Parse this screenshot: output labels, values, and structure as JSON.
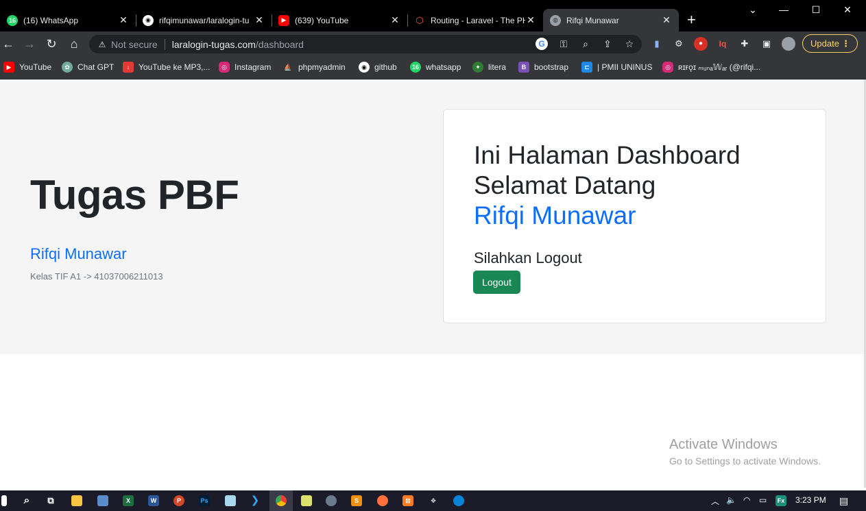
{
  "browser": {
    "tabs": [
      {
        "title": "(16) WhatsApp",
        "icon": "whatsapp-icon",
        "color": "#25d366"
      },
      {
        "title": "rifqimunawar/laralogin-tu",
        "icon": "github-icon",
        "color": "#ffffff"
      },
      {
        "title": "(639) YouTube",
        "icon": "youtube-icon",
        "color": "#ff0000"
      },
      {
        "title": "Routing - Laravel - The PH",
        "icon": "laravel-icon",
        "color": "#f05340"
      },
      {
        "title": "Rifqi Munawar",
        "icon": "globe-icon",
        "color": "#9aa0a6"
      }
    ],
    "whatsapp_badge": "16",
    "active_tab_index": 4,
    "omnibox": {
      "security_label": "Not secure",
      "host": "laralogin-tugas.com",
      "path": "/dashboard"
    },
    "update_label": "Update",
    "bookmarks": [
      {
        "label": "YouTube",
        "icon": "youtube-icon",
        "color": "#ff0000"
      },
      {
        "label": "Chat GPT",
        "icon": "chatgpt-icon",
        "color": "#74aa9c"
      },
      {
        "label": "YouTube ke MP3,...",
        "icon": "download-icon",
        "color": "#e53935"
      },
      {
        "label": "Instagram",
        "icon": "instagram-icon",
        "color": "#d62976"
      },
      {
        "label": "phpmyadmin",
        "icon": "phpmyadmin-icon",
        "color": "#f89c0e"
      },
      {
        "label": "github",
        "icon": "github-icon",
        "color": "#ffffff"
      },
      {
        "label": "whatsapp",
        "icon": "whatsapp-icon",
        "color": "#25d366"
      },
      {
        "label": "litera",
        "icon": "litera-icon",
        "color": "#2e7d32"
      },
      {
        "label": "bootstrap",
        "icon": "bootstrap-icon",
        "color": "#7952b3"
      },
      {
        "label": "| PMII UNINUS",
        "icon": "pmii-icon",
        "color": "#1e88e5"
      },
      {
        "label": "ʀɪғǫɪ ₘᵤₙₐ𝕎ₐᵣ (@rifqi...",
        "icon": "instagram-icon",
        "color": "#d62976"
      }
    ],
    "bookmark_whatsapp_badge": "16",
    "bootstrap_letter": "B"
  },
  "page": {
    "hero": {
      "title": "Tugas PBF",
      "name": "Rifqi Munawar",
      "subtitle": "Kelas TIF A1 -> 41037006211013"
    },
    "card": {
      "line1": "Ini Halaman Dashboard",
      "line2": "Selamat Datang",
      "name": "Rifqi Munawar",
      "prompt": "Silahkan Logout",
      "button": "Logout"
    },
    "colors": {
      "primary": "#0d6efd",
      "success": "#198754",
      "text": "#212529"
    }
  },
  "watermark": {
    "line1": "Activate Windows",
    "line2": "Go to Settings to activate Windows."
  },
  "taskbar": {
    "clock": "3:23 PM"
  }
}
